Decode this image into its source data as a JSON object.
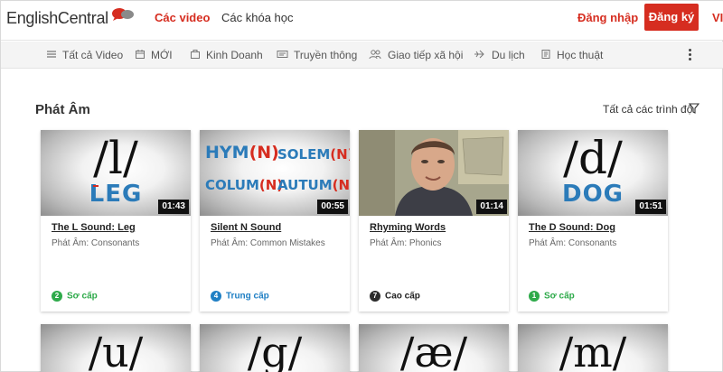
{
  "header": {
    "logo_text": "EnglishCentral",
    "nav": {
      "videos": "Các video",
      "courses": "Các khóa học"
    },
    "login": "Đăng nhập",
    "signup": "Đăng ký",
    "language": "VI"
  },
  "categories": [
    {
      "label": "Tất cả Video",
      "icon": "list-icon"
    },
    {
      "label": "MỚI",
      "icon": "calendar-icon"
    },
    {
      "label": "Kinh Doanh",
      "icon": "briefcase-icon"
    },
    {
      "label": "Truyền thông",
      "icon": "media-icon"
    },
    {
      "label": "Giao tiếp xã hội",
      "icon": "people-icon"
    },
    {
      "label": "Du lịch",
      "icon": "travel-icon"
    },
    {
      "label": "Học thuật",
      "icon": "academic-icon"
    }
  ],
  "section": {
    "title": "Phát Âm",
    "level_filter": "Tất cả các trình độ"
  },
  "videos": [
    {
      "title": "The L Sound: Leg",
      "subtitle": "Phát Âm: Consonants",
      "duration": "01:43",
      "thumb_symbol": "/l/",
      "thumb_word": "LEG",
      "level_num": "2",
      "level_label": "Sơ cấp",
      "level_color": "#2eaa4a"
    },
    {
      "title": "Silent N Sound",
      "subtitle": "Phát Âm: Common Mistakes",
      "duration": "00:55",
      "thumb_lines": [
        [
          "HYM",
          "(N)",
          "SOLEM",
          "(N)"
        ],
        [
          "COLUM",
          "(N)",
          "AUTUM",
          "(N)"
        ]
      ],
      "level_num": "4",
      "level_label": "Trung cấp",
      "level_color": "#1f7fc4"
    },
    {
      "title": "Rhyming Words",
      "subtitle": "Phát Âm: Phonics",
      "duration": "01:14",
      "level_num": "7",
      "level_label": "Cao cấp",
      "level_color": "#2b2b2b"
    },
    {
      "title": "The D Sound: Dog",
      "subtitle": "Phát Âm: Consonants",
      "duration": "01:51",
      "thumb_symbol": "/d/",
      "thumb_word": "DOG",
      "level_num": "1",
      "level_label": "Sơ cấp",
      "level_color": "#2eaa4a"
    }
  ],
  "second_row": [
    {
      "thumb_symbol": "/u/"
    },
    {
      "thumb_symbol": "/g/"
    },
    {
      "thumb_symbol": "/æ/"
    },
    {
      "thumb_symbol": "/m/"
    }
  ],
  "colors": {
    "brand": "#d62d20",
    "accent_blue": "#2b7bb9"
  }
}
